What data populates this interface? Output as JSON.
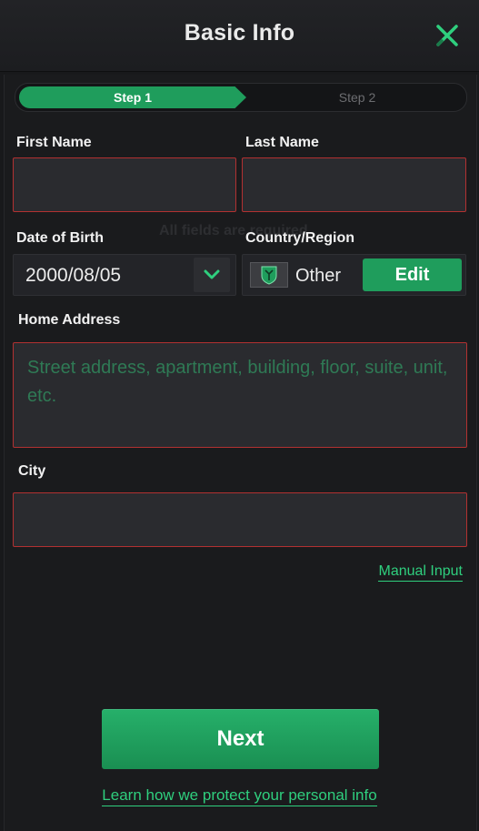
{
  "header": {
    "title": "Basic Info",
    "close_icon": "close-x-icon"
  },
  "stepper": {
    "steps": [
      {
        "label": "Step 1",
        "active": true
      },
      {
        "label": "Step 2",
        "active": false
      }
    ]
  },
  "form": {
    "first_name": {
      "label": "First Name",
      "value": ""
    },
    "last_name": {
      "label": "Last Name",
      "value": ""
    },
    "notice": "All fields are required",
    "dob": {
      "label": "Date of Birth",
      "value": "2000/08/05",
      "icon": "chevron-down-icon"
    },
    "country": {
      "label": "Country/Region",
      "value": "Other",
      "flag_icon": "flag-emblem-icon",
      "edit_label": "Edit"
    },
    "address": {
      "label": "Home Address",
      "placeholder": "Street address, apartment, building, floor, suite, unit, etc.",
      "value": ""
    },
    "city": {
      "label": "City",
      "value": ""
    },
    "manual_input_label": "Manual Input"
  },
  "footer": {
    "next_label": "Next",
    "learn_label": "Learn how we protect your personal info"
  },
  "colors": {
    "accent": "#1f9d5c",
    "link": "#2fcf7e",
    "error_border": "#b23131",
    "background": "#1a1b1d"
  }
}
